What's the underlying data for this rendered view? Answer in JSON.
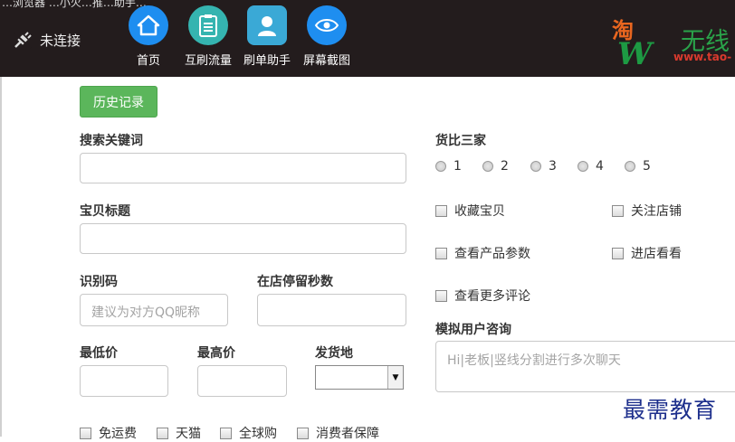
{
  "window": {
    "title_fragment": "…浏览器 …小火…推…助手…"
  },
  "connection": {
    "status": "未连接",
    "icon": "plug-disconnected-icon"
  },
  "nav": {
    "items": [
      {
        "label": "首页",
        "icon": "home-icon",
        "color": "#1e8ef0"
      },
      {
        "label": "互刷流量",
        "icon": "clipboard-icon",
        "color": "#35b4b0"
      },
      {
        "label": "刷单助手",
        "icon": "user-icon",
        "color": "#3aa9d6"
      },
      {
        "label": "屏幕截图",
        "icon": "eye-icon",
        "color": "#1e8ef0"
      }
    ]
  },
  "logo": {
    "tao": "淘",
    "wuxian": "无线",
    "w": "W",
    "url": "www.tao-"
  },
  "history": {
    "label": "历史记录"
  },
  "form": {
    "keyword": {
      "label": "搜索关键词",
      "value": ""
    },
    "title": {
      "label": "宝贝标题",
      "value": ""
    },
    "code": {
      "label": "识别码",
      "placeholder": "建议为对方QQ昵称"
    },
    "stay_seconds": {
      "label": "在店停留秒数",
      "value": ""
    },
    "min_price": {
      "label": "最低价",
      "value": ""
    },
    "max_price": {
      "label": "最高价",
      "value": ""
    },
    "ship_from": {
      "label": "发货地",
      "value": ""
    },
    "filters": [
      "免运费",
      "天猫",
      "全球购",
      "消费者保障"
    ]
  },
  "right": {
    "compare": {
      "label": "货比三家",
      "options": [
        "1",
        "2",
        "3",
        "4",
        "5"
      ]
    },
    "actions": [
      "收藏宝贝",
      "关注店铺",
      "查看产品参数",
      "进店看看",
      "查看更多评论"
    ],
    "chat": {
      "label": "模拟用户咨询",
      "placeholder": "Hi|老板|竖线分割进行多次聊天"
    }
  },
  "watermark": "最需教育"
}
